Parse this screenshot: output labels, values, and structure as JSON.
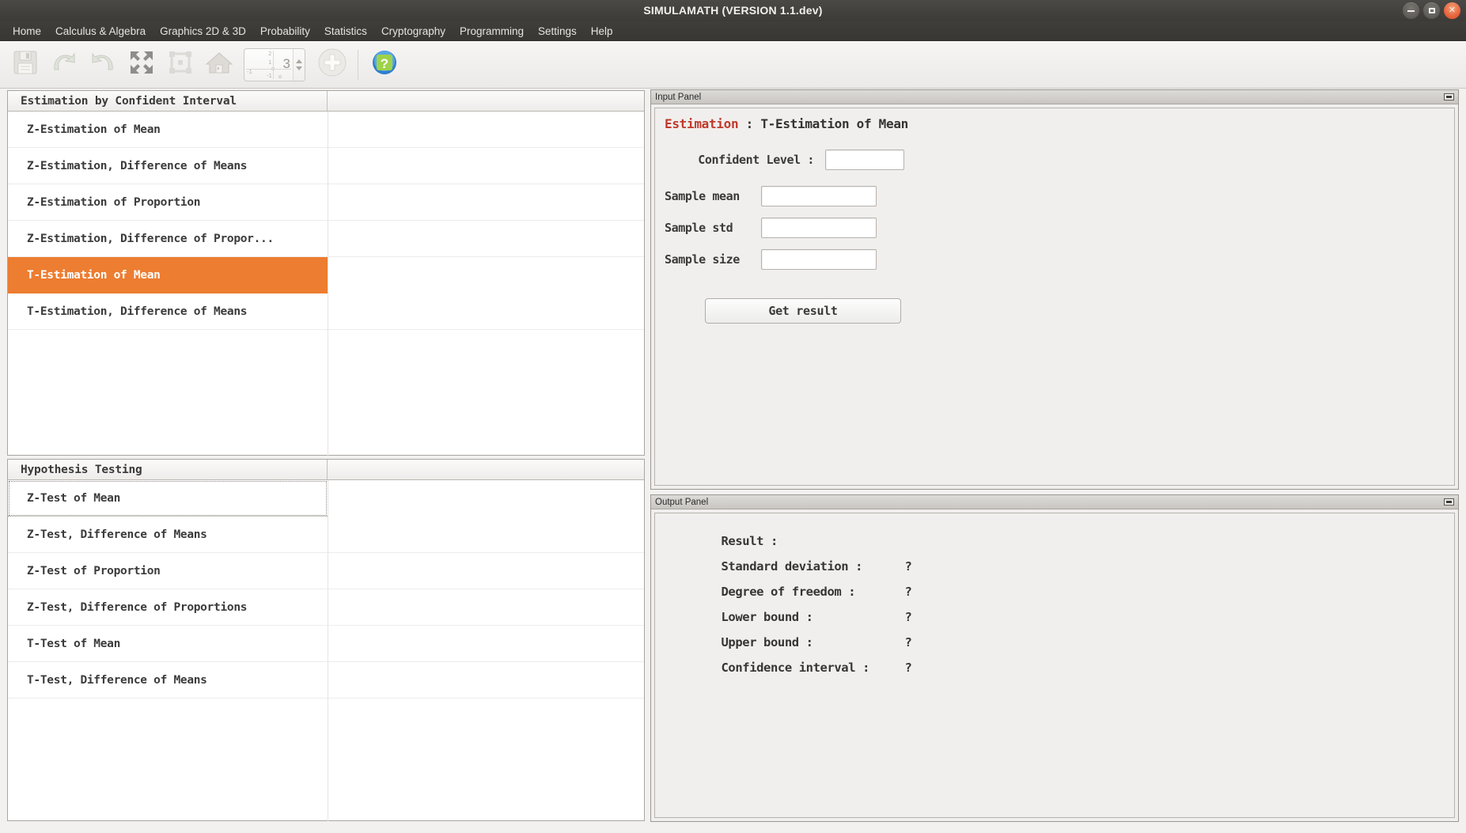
{
  "window": {
    "title": "SIMULAMATH   (VERSION 1.1.dev)",
    "controls": [
      {
        "name": "minimize",
        "glyph": "dash"
      },
      {
        "name": "maximize",
        "glyph": "square"
      },
      {
        "name": "close",
        "glyph": "x"
      }
    ]
  },
  "menubar": {
    "items": [
      {
        "label": "Home"
      },
      {
        "label": "Calculus & Algebra"
      },
      {
        "label": "Graphics 2D & 3D"
      },
      {
        "label": "Probability"
      },
      {
        "label": "Statistics"
      },
      {
        "label": "Cryptography"
      },
      {
        "label": "Programming"
      },
      {
        "label": "Settings"
      },
      {
        "label": "Help"
      }
    ]
  },
  "toolbar": {
    "buttons": [
      {
        "name": "save-icon",
        "tip": "Save"
      },
      {
        "name": "undo-icon",
        "tip": "Undo"
      },
      {
        "name": "redo-icon",
        "tip": "Redo"
      },
      {
        "name": "expand-icon",
        "tip": "Expand"
      },
      {
        "name": "select-region-icon",
        "tip": "Select region"
      },
      {
        "name": "home-icon",
        "tip": "Home"
      }
    ],
    "spinner": {
      "value": "3",
      "axis_labels": [
        "2",
        "1",
        "-1",
        "-1"
      ]
    },
    "add_icon": "plus-circle-icon",
    "help_icon": "help-question-icon"
  },
  "estimation_table": {
    "header": "Estimation by Confident Interval",
    "rows": [
      {
        "label": "Z-Estimation of Mean",
        "selected": false
      },
      {
        "label": "Z-Estimation, Difference of Means",
        "selected": false
      },
      {
        "label": "Z-Estimation of Proportion",
        "selected": false
      },
      {
        "label": "Z-Estimation, Difference of Propor...",
        "selected": false
      },
      {
        "label": "T-Estimation of Mean",
        "selected": true
      },
      {
        "label": "T-Estimation, Difference of Means",
        "selected": false
      }
    ]
  },
  "hypothesis_table": {
    "header": "Hypothesis Testing",
    "rows": [
      {
        "label": "Z-Test of Mean",
        "focused": true
      },
      {
        "label": "Z-Test, Difference of Means",
        "focused": false
      },
      {
        "label": "Z-Test of Proportion",
        "focused": false
      },
      {
        "label": "Z-Test, Difference of Proportions",
        "focused": false
      },
      {
        "label": "T-Test of Mean",
        "focused": false
      },
      {
        "label": "T-Test, Difference of Means",
        "focused": false
      }
    ]
  },
  "input_panel": {
    "title": "Input Panel",
    "heading_prefix": "Estimation",
    "heading_suffix": " : T-Estimation of Mean",
    "fields": [
      {
        "label": "Confident Level :",
        "value": "",
        "placeholder": ""
      },
      {
        "label": "Sample mean",
        "value": "",
        "placeholder": ""
      },
      {
        "label": "Sample std",
        "value": "",
        "placeholder": ""
      },
      {
        "label": "Sample size",
        "value": "",
        "placeholder": ""
      }
    ],
    "submit_label": "Get result"
  },
  "output_panel": {
    "title": "Output Panel",
    "lines": [
      {
        "label": "Result :",
        "value": ""
      },
      {
        "label": "Standard deviation :",
        "value": "?"
      },
      {
        "label": "Degree of freedom :",
        "value": "?"
      },
      {
        "label": "Lower bound :",
        "value": "?"
      },
      {
        "label": "Upper bound :",
        "value": "?"
      },
      {
        "label": "Confidence interval :",
        "value": "?"
      }
    ]
  },
  "colors": {
    "selection": "#ed7d31",
    "accent_red": "#c0392b",
    "titlebar": "#3c3b37",
    "close_button": "#e8633a"
  }
}
